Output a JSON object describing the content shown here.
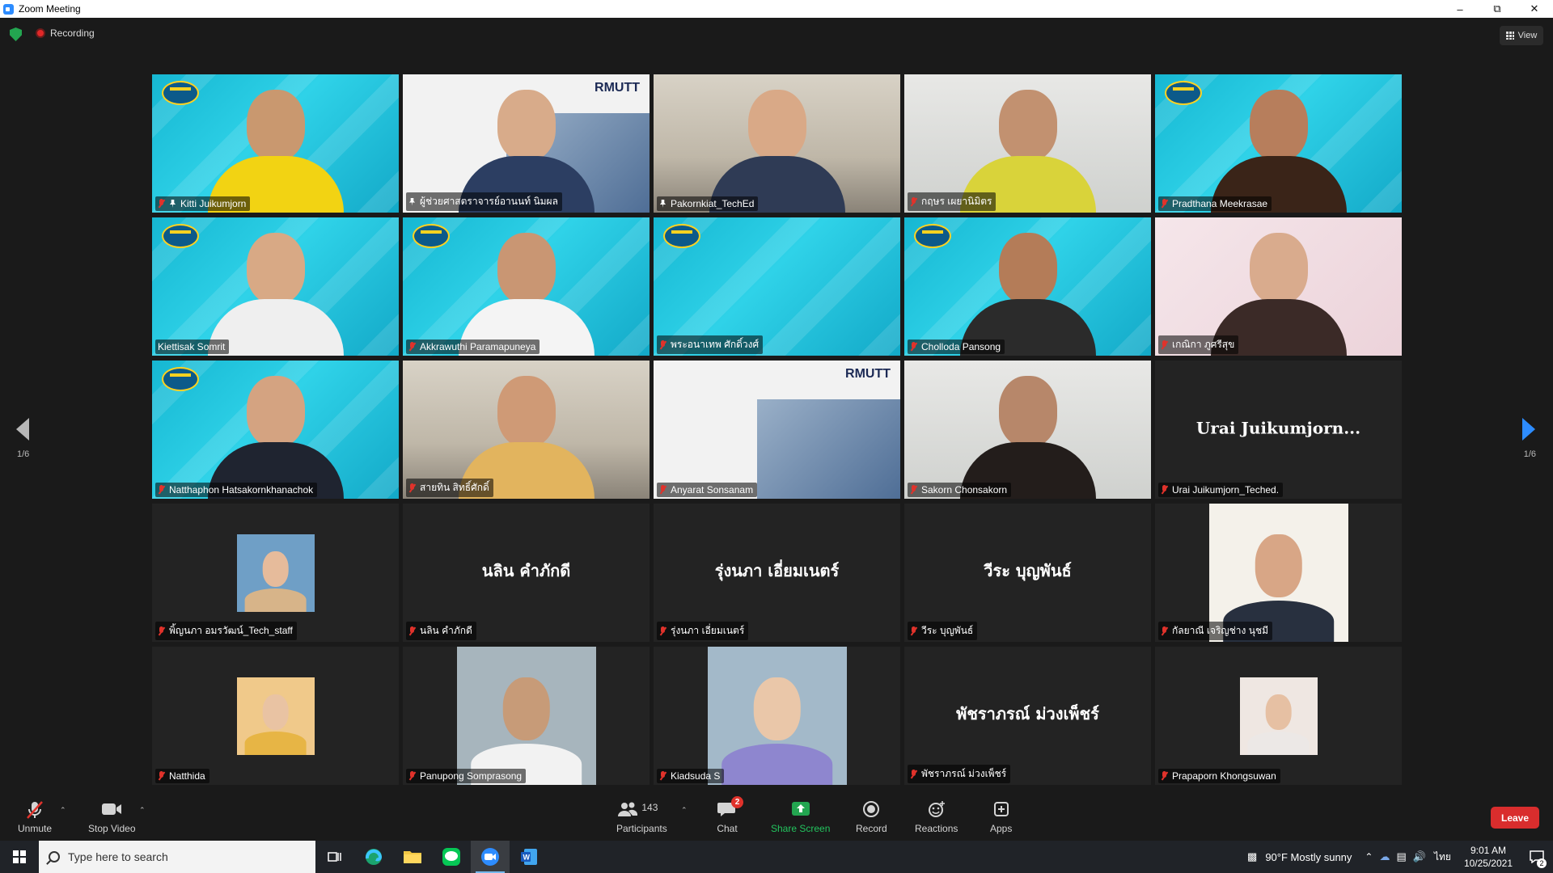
{
  "window": {
    "title": "Zoom Meeting"
  },
  "meeting": {
    "recording_label": "Recording",
    "view_label": "View"
  },
  "pagination": {
    "left": "1/6",
    "right": "1/6"
  },
  "tiles": [
    {
      "name": "Kitti Juikumjorn",
      "muted": true,
      "pinned": true,
      "type": "video",
      "bg": "cyan",
      "head": "#c9986f",
      "shirt": "#f2d313"
    },
    {
      "name": "ผู้ช่วยศาสตราจารย์อานนท์ นิมผล",
      "muted": false,
      "pinned": true,
      "type": "video",
      "bg": "white",
      "head": "#d8ab8a",
      "shirt": "#2c3e62",
      "overlay": "RMUTT"
    },
    {
      "name": "Pakornkiat_TechEd",
      "muted": false,
      "pinned": true,
      "type": "video",
      "bg": "room",
      "head": "#d9a987",
      "shirt": "#2f3b55",
      "active": true
    },
    {
      "name": "กฤษร เผยานิมิตร",
      "muted": true,
      "pinned": false,
      "type": "video",
      "bg": "office",
      "head": "#c29170",
      "shirt": "#d9d33a"
    },
    {
      "name": "Pradthana Meekrasae",
      "muted": true,
      "pinned": false,
      "type": "video",
      "bg": "cyan",
      "head": "#b77e5c",
      "shirt": "#3a2418"
    },
    {
      "name": "Kiettisak Somrit",
      "muted": false,
      "pinned": false,
      "type": "video",
      "bg": "cyan",
      "head": "#d8a985",
      "shirt": "#efefef"
    },
    {
      "name": "Akkrawuthi Paramapuneya",
      "muted": true,
      "pinned": false,
      "type": "video",
      "bg": "cyan",
      "head": "#c99673",
      "shirt": "#f4f4f4"
    },
    {
      "name": "พระอนาเทพ ศักดิ์วงศ์",
      "muted": true,
      "pinned": false,
      "type": "video",
      "bg": "cyan",
      "head": null,
      "shirt": null
    },
    {
      "name": "Cholloda Pansong",
      "muted": true,
      "pinned": false,
      "type": "video",
      "bg": "cyan",
      "head": "#b47c58",
      "shirt": "#2b2b2b"
    },
    {
      "name": "เกณิกา ภูศรีสุข",
      "muted": true,
      "pinned": false,
      "type": "video",
      "bg": "pink",
      "head": "#d9ab8d",
      "shirt": "#3b2a27"
    },
    {
      "name": "Natthaphon Hatsakornkhanachok",
      "muted": true,
      "pinned": false,
      "type": "video",
      "bg": "cyan",
      "head": "#d4a381",
      "shirt": "#1f2430"
    },
    {
      "name": "สายทิน สิทธิ์ศักดิ์",
      "muted": true,
      "pinned": false,
      "type": "video",
      "bg": "room",
      "head": "#cf9a76",
      "shirt": "#e2b45e"
    },
    {
      "name": "Anyarat Sonsanam",
      "muted": true,
      "pinned": false,
      "type": "video",
      "bg": "white",
      "head": null,
      "shirt": null,
      "overlay": "RMUTT"
    },
    {
      "name": "Sakorn Chonsakorn",
      "muted": true,
      "pinned": false,
      "type": "video",
      "bg": "office",
      "head": "#b7876a",
      "shirt": "#231d1b"
    },
    {
      "name": "Urai Juikumjorn_Teched.",
      "muted": true,
      "pinned": false,
      "type": "name",
      "display": "Urai  Juikumjorn..."
    },
    {
      "name": "พิ้ญนภา อมรวัฒน์_Tech_staff",
      "muted": true,
      "pinned": false,
      "type": "avatar",
      "avatar_bg": "#6f9fc6",
      "face": "#e6bb9b",
      "shoulder": "#d7b489"
    },
    {
      "name": "นลิน คำภักดี",
      "muted": true,
      "pinned": false,
      "type": "name",
      "display": "นลิน คำภักดี"
    },
    {
      "name": "รุ่งนภา เอี่ยมเนตร์",
      "muted": true,
      "pinned": false,
      "type": "name",
      "display": "รุ่งนภา เอี่ยมเนตร์"
    },
    {
      "name": "วีระ บุญพันธ์",
      "muted": true,
      "pinned": false,
      "type": "name",
      "display": "วีระ บุญพันธ์"
    },
    {
      "name": "กัลยาณี เจริญช่าง นุชมี",
      "muted": true,
      "pinned": false,
      "type": "avatar-tall",
      "avatar_bg": "#f4f1ea",
      "face": "#d8a686",
      "shoulder": "#28303f"
    },
    {
      "name": "Natthida",
      "muted": true,
      "pinned": false,
      "type": "avatar",
      "avatar_bg": "#f0c98a",
      "face": "#e9c3a3",
      "shoulder": "#e7b545"
    },
    {
      "name": "Panupong Somprasong",
      "muted": true,
      "pinned": false,
      "type": "avatar-tall",
      "avatar_bg": "#a7b5bd",
      "face": "#c79b78",
      "shoulder": "#f2f2f2"
    },
    {
      "name": "Kiadsuda S",
      "muted": true,
      "pinned": false,
      "type": "avatar-tall",
      "avatar_bg": "#a3b9c9",
      "face": "#eac7a9",
      "shoulder": "#8e86cf"
    },
    {
      "name": "พัชราภรณ์ ม่วงเพ็ชร์",
      "muted": true,
      "pinned": false,
      "type": "name",
      "display": "พัชราภรณ์ ม่วงเพ็ชร์"
    },
    {
      "name": "Prapaporn Khongsuwan",
      "muted": true,
      "pinned": false,
      "type": "avatar",
      "avatar_bg": "#efe7e2",
      "face": "#e6c0a3",
      "shoulder": "#ece8e6"
    }
  ],
  "toolbar": {
    "unmute": "Unmute",
    "stop_video": "Stop Video",
    "participants": "Participants",
    "participant_count": "143",
    "chat": "Chat",
    "chat_badge": "2",
    "share_screen": "Share Screen",
    "record": "Record",
    "reactions": "Reactions",
    "apps": "Apps",
    "leave": "Leave"
  },
  "taskbar": {
    "search_placeholder": "Type here to search",
    "weather": "90°F  Mostly sunny",
    "lang": "ไทย",
    "time": "9:01 AM",
    "date": "10/25/2021",
    "notif_count": "2"
  },
  "colors": {
    "zoom_blue": "#2d8cff",
    "leave_red": "#d92d2d",
    "share_green": "#23a550",
    "active_speaker": "#e2e84a"
  }
}
